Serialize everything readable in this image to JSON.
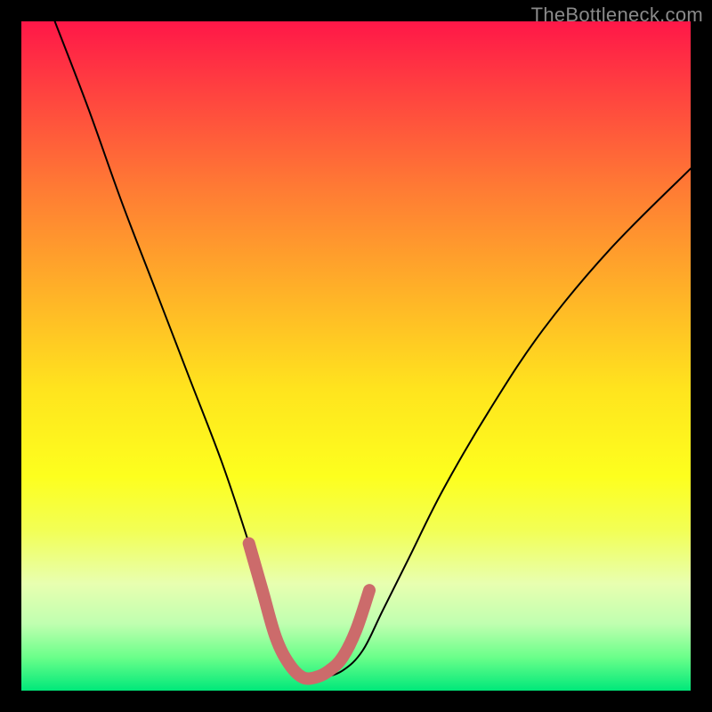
{
  "watermark": "TheBottleneck.com",
  "chart_data": {
    "type": "line",
    "title": "",
    "xlabel": "",
    "ylabel": "",
    "xlim": [
      0,
      100
    ],
    "ylim": [
      0,
      100
    ],
    "series": [
      {
        "name": "bottleneck-curve",
        "x": [
          5,
          10,
          15,
          20,
          25,
          30,
          34,
          37,
          39,
          41,
          43,
          45,
          48,
          51,
          54,
          58,
          63,
          70,
          78,
          88,
          100
        ],
        "values": [
          100,
          87,
          73,
          60,
          47,
          34,
          22,
          12,
          6,
          3,
          2,
          2,
          3,
          6,
          12,
          20,
          30,
          42,
          54,
          66,
          78
        ]
      }
    ],
    "highlight": {
      "name": "trough-marker",
      "color": "#cc6b6b",
      "x": [
        34,
        36,
        38,
        40,
        42,
        44,
        46,
        48,
        50,
        52
      ],
      "values": [
        22,
        15,
        8,
        4,
        2,
        2,
        3,
        5,
        9,
        15
      ]
    }
  }
}
